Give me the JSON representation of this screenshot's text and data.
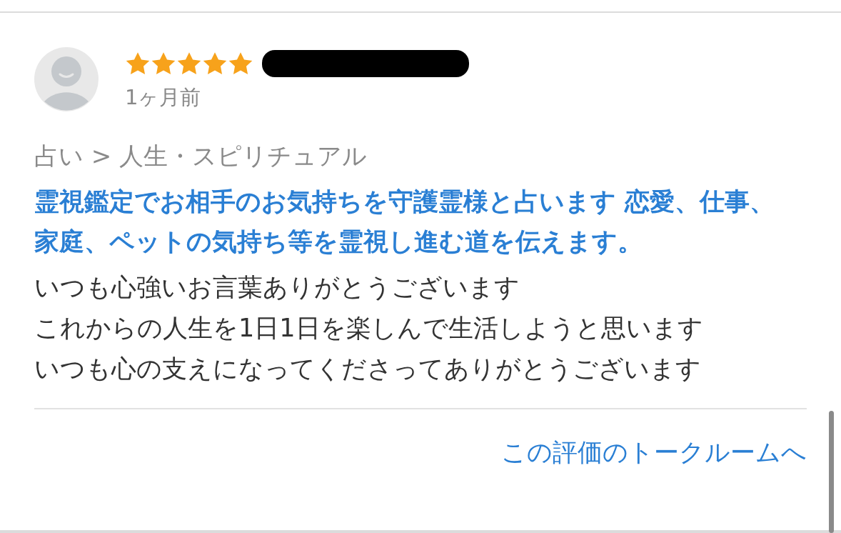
{
  "review": {
    "stars": 5,
    "time": "1ヶ月前",
    "redacted": true,
    "category": "占い > 人生・スピリチュアル",
    "service_title": "霊視鑑定でお相手のお気持ちを守護霊様と占います 恋愛、仕事、家庭、ペットの気持ち等を霊視し進む道を伝えます。",
    "comment_lines": [
      "いつも心強いお言葉ありがとうございます",
      "これからの人生を1日1日を楽しんで生活しようと思います",
      "いつも心の支えになってくださってありがとうございます"
    ],
    "talkroom_link": "この評価のトークルームへ"
  }
}
